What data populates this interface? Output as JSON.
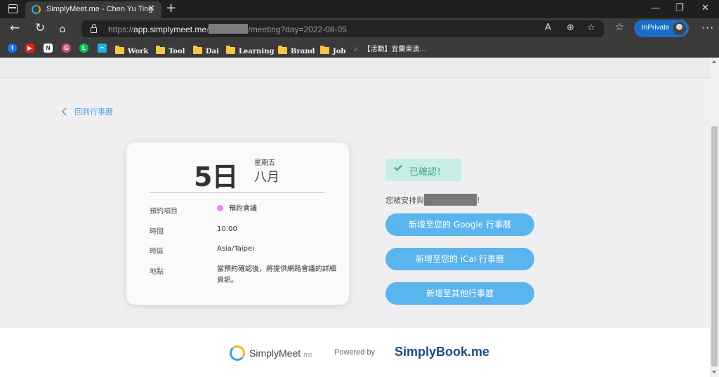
{
  "browser": {
    "tab_title": "SimplyMeet.me - Chen Yu Ting",
    "tab_close": "✕",
    "new_tab": "+",
    "window_controls": {
      "minimize": "—",
      "restore": "❐",
      "close": "✕"
    },
    "url_prefix": "https://",
    "url_host": "app.simplymeet.me",
    "url_sep": "/",
    "url_path": "/meeting?day=2022-08-05",
    "inprivate_label": "InPrivate",
    "menu": "···"
  },
  "bookmarks": {
    "icons": [
      {
        "name": "facebook-icon",
        "glyph": "f",
        "color": "#1877f2"
      },
      {
        "name": "youtube-icon",
        "glyph": "▶",
        "color": "#e62117"
      },
      {
        "name": "notion-icon",
        "glyph": "N",
        "color": "#ffffff"
      },
      {
        "name": "gmail-like-icon",
        "glyph": "G",
        "color": "#d04f87"
      },
      {
        "name": "line-icon",
        "glyph": "L",
        "color": "#06c755"
      },
      {
        "name": "bilibili-icon",
        "glyph": "B",
        "color": "#23ade5"
      }
    ],
    "folders": [
      "Work",
      "Tool",
      "Dai",
      "Learning",
      "Brand",
      "Job"
    ],
    "activity": "【活動】宜蘭東澳..."
  },
  "page": {
    "back_link": "回到行事曆",
    "card": {
      "day": "5日",
      "weekday": "星期五",
      "month": "八月",
      "rows": [
        {
          "label": "預約項目",
          "value": "預約會議"
        },
        {
          "label": "時間",
          "value": "10:00"
        },
        {
          "label": "時區",
          "value": "Asia/Taipei"
        },
        {
          "label": "地點",
          "value": "當預約確認後，將提供網路會議的詳細資訊。"
        }
      ]
    },
    "confirmed": "已確認！",
    "arranged_prefix": "您被安排與",
    "arranged_suffix": "!",
    "buttons": {
      "google": "新增至您的 Google 行事曆",
      "ical": "新增至您的 iCal 行事曆",
      "other": "新增至其他行事曆"
    },
    "footer": {
      "simplymeet": "SimplyMeet",
      "simplymeet_suffix": ".me",
      "powered_by": "Powered by",
      "simplybook": "SimplyBook.me"
    }
  },
  "colors": {
    "button": "#5ab4ed",
    "confirmed_bg": "#c8ece6",
    "confirmed_text": "#3ba58f",
    "link": "#5aa7e6",
    "booking_dot": "#f08be8"
  }
}
